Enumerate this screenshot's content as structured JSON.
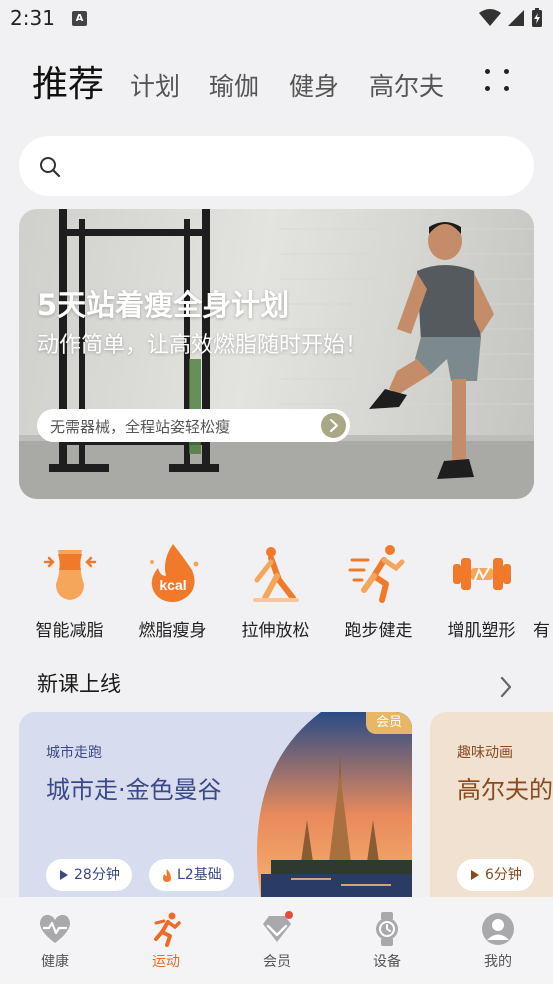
{
  "status": {
    "time": "2:31",
    "notif_label": "A"
  },
  "top_tabs": [
    {
      "label": "推荐",
      "active": true
    },
    {
      "label": "计划"
    },
    {
      "label": "瑜伽"
    },
    {
      "label": "健身"
    },
    {
      "label": "高尔夫"
    }
  ],
  "search": {
    "placeholder": ""
  },
  "banner": {
    "title": "5天站着瘦全身计划",
    "subtitle": "动作简单，让高效燃脂随时开始！",
    "pill_text": "无需器械，全程站姿轻松瘦"
  },
  "categories": [
    {
      "label": "智能减脂",
      "icon": "waist-icon"
    },
    {
      "label": "燃脂瘦身",
      "icon": "kcal-flame-icon",
      "icon_text": "kcal"
    },
    {
      "label": "拉伸放松",
      "icon": "stretch-icon"
    },
    {
      "label": "跑步健走",
      "icon": "running-icon"
    },
    {
      "label": "增肌塑形",
      "icon": "dumbbell-icon"
    },
    {
      "label": "有"
    }
  ],
  "new_courses": {
    "title": "新课上线",
    "items": [
      {
        "category": "城市走跑",
        "title": "城市走·金色曼谷",
        "badge": "会员",
        "duration": "28分钟",
        "level": "L2基础"
      },
      {
        "category": "趣味动画",
        "title": "高尔夫的",
        "duration": "6分钟"
      }
    ]
  },
  "bottom_nav": [
    {
      "label": "健康",
      "icon": "heart-pulse-icon"
    },
    {
      "label": "运动",
      "icon": "runner-icon",
      "active": true
    },
    {
      "label": "会员",
      "icon": "diamond-icon",
      "has_dot": true
    },
    {
      "label": "设备",
      "icon": "watch-icon"
    },
    {
      "label": "我的",
      "icon": "avatar-icon"
    }
  ],
  "colors": {
    "accent": "#f06a26",
    "background": "#f1f1f3",
    "course_blue": "#3b4a86",
    "course_brown": "#8a4a1f",
    "vip_gold": "#e6b866"
  }
}
